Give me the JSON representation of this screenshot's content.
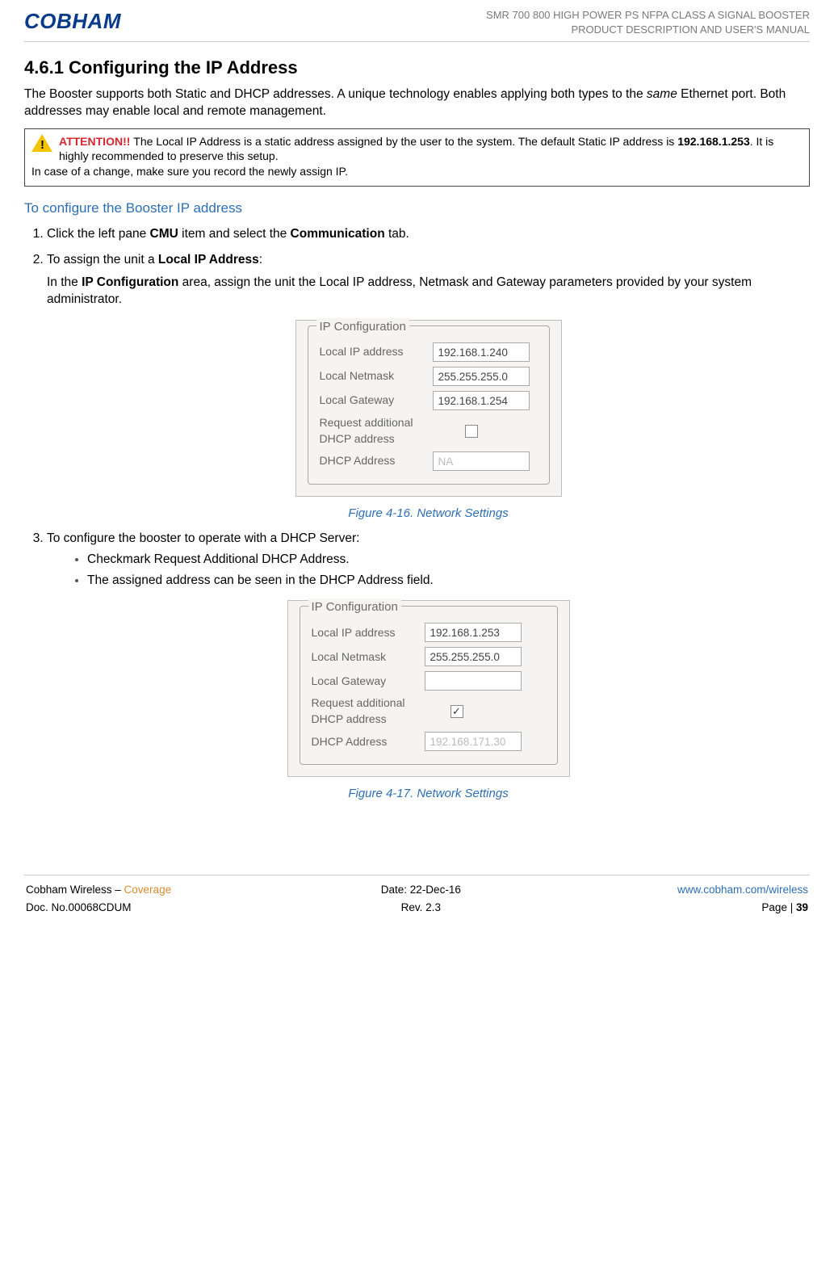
{
  "header": {
    "logo_text": "COBHAM",
    "line1": "SMR 700 800 HIGH POWER PS NFPA CLASS A SIGNAL BOOSTER",
    "line2": "PRODUCT DESCRIPTION AND USER'S MANUAL"
  },
  "section": {
    "number_title": "4.6.1   Configuring the IP Address",
    "intro_pre": "The Booster supports both Static and DHCP addresses. A unique technology enables applying both types to the ",
    "intro_same": "same",
    "intro_post": " Ethernet port. Both addresses may enable local and remote management."
  },
  "attention": {
    "label": "ATTENTION!! ",
    "line1a": "The Local IP Address is a static address assigned by the user to the system. The default Static IP address is ",
    "default_ip": "192.168.1.253",
    "line1b": ". It is highly recommended to preserve this setup.",
    "line2": "In case of a change, make sure you record the newly assign IP."
  },
  "subhead": "To configure the Booster IP address",
  "steps": {
    "s1_a": "Click the left pane ",
    "s1_b": "CMU",
    "s1_c": " item and select the ",
    "s1_d": "Communication",
    "s1_e": " tab.",
    "s2_a": "To assign the unit a ",
    "s2_b": "Local IP Address",
    "s2_c": ":",
    "s2_sub_a": "In the ",
    "s2_sub_b": "IP Configuration",
    "s2_sub_c": " area, assign the unit the Local IP address, Netmask and Gateway parameters provided by your system administrator.",
    "s3": "To configure the booster to operate with a DHCP Server:",
    "s3_b1": "Checkmark Request Additional DHCP Address.",
    "s3_b2": "The assigned address can be seen in the DHCP Address field."
  },
  "panel1": {
    "legend": "IP Configuration",
    "rows": {
      "ip_label": "Local IP address",
      "ip_value": "192.168.1.240",
      "nm_label": "Local Netmask",
      "nm_value": "255.255.255.0",
      "gw_label": "Local Gateway",
      "gw_value": "192.168.1.254",
      "req_label1": "Request additional",
      "req_label2": "DHCP address",
      "req_checked": "",
      "dhcp_label": "DHCP Address",
      "dhcp_value": "NA"
    },
    "caption": "Figure 4-16. Network Settings"
  },
  "panel2": {
    "legend": "IP Configuration",
    "rows": {
      "ip_label": "Local IP address",
      "ip_value": "192.168.1.253",
      "nm_label": "Local Netmask",
      "nm_value": "255.255.255.0",
      "gw_label": "Local Gateway",
      "gw_value": "",
      "req_label1": "Request additional",
      "req_label2": "DHCP address",
      "req_checked": "✓",
      "dhcp_label": "DHCP Address",
      "dhcp_value": "192.168.171.30"
    },
    "caption": "Figure 4-17. Network Settings"
  },
  "footer": {
    "l1a": "Cobham Wireless – ",
    "l1b": "Coverage",
    "l2": "Doc. No.00068CDUM",
    "c1": "Date: 22-Dec-16",
    "c2": "Rev. 2.3",
    "r1": "www.cobham.com/wireless",
    "r2a": "Page | ",
    "r2b": "39"
  }
}
